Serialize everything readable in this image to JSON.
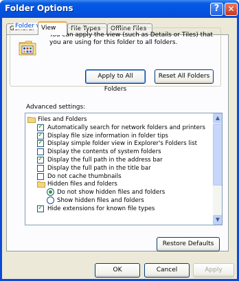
{
  "window": {
    "title": "Folder Options"
  },
  "titlebar": {
    "help_glyph": "?",
    "close_glyph": "✕"
  },
  "tabs": [
    {
      "label": "General",
      "active": false
    },
    {
      "label": "View",
      "active": true
    },
    {
      "label": "File Types",
      "active": false
    },
    {
      "label": "Offline Files",
      "active": false
    }
  ],
  "folder_views": {
    "title": "Folder views",
    "description": "You can apply the view (such as Details or Tiles) that you are using for this folder to all folders.",
    "apply_all": "Apply to All Folders",
    "reset_all": "Reset All Folders"
  },
  "advanced": {
    "label": "Advanced settings:",
    "items": [
      {
        "type": "folder",
        "label": "Files and Folders",
        "indent": 0
      },
      {
        "type": "check",
        "checked": true,
        "label": "Automatically search for network folders and printers",
        "indent": 1
      },
      {
        "type": "check",
        "checked": true,
        "label": "Display file size information in folder tips",
        "indent": 1
      },
      {
        "type": "check",
        "checked": true,
        "label": "Display simple folder view in Explorer's Folders list",
        "indent": 1
      },
      {
        "type": "check",
        "checked": false,
        "label": "Display the contents of system folders",
        "indent": 1
      },
      {
        "type": "check",
        "checked": true,
        "label": "Display the full path in the address bar",
        "indent": 1
      },
      {
        "type": "check",
        "checked": false,
        "label": "Display the full path in the title bar",
        "indent": 1
      },
      {
        "type": "check",
        "checked": false,
        "label": "Do not cache thumbnails",
        "indent": 1
      },
      {
        "type": "folder",
        "label": "Hidden files and folders",
        "indent": 1
      },
      {
        "type": "radio",
        "selected": true,
        "label": "Do not show hidden files and folders",
        "indent": 2
      },
      {
        "type": "radio",
        "selected": false,
        "label": "Show hidden files and folders",
        "indent": 2
      },
      {
        "type": "check",
        "checked": true,
        "label": "Hide extensions for known file types",
        "indent": 1
      }
    ]
  },
  "scroll": {
    "up_glyph": "▲",
    "down_glyph": "▼"
  },
  "buttons": {
    "restore": "Restore Defaults",
    "ok": "OK",
    "cancel": "Cancel",
    "apply": "Apply"
  },
  "colors": {
    "title_bar": "#0054e3",
    "group_title": "#0046d5",
    "check_mark": "#21a121",
    "active_tab_accent": "#f3a43b"
  }
}
